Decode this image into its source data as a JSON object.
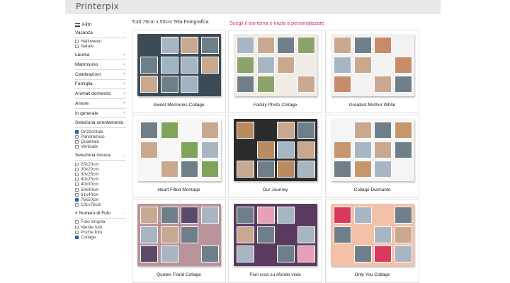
{
  "header": {
    "logo": "Printerpix"
  },
  "sidebar": {
    "filters_label": "Filtri",
    "sections": [
      {
        "label": "Vacanza",
        "chevron": "-",
        "options": [
          {
            "label": "Halloween",
            "checked": false
          },
          {
            "label": "Natale",
            "checked": false
          }
        ]
      },
      {
        "label": "Laurea",
        "chevron": "+"
      },
      {
        "label": "Matrimonio",
        "chevron": "+"
      },
      {
        "label": "Celebrazioni",
        "chevron": "+"
      },
      {
        "label": "Famiglia",
        "chevron": "+"
      },
      {
        "label": "Animali domestici",
        "chevron": "+"
      },
      {
        "label": "Amore",
        "chevron": "+"
      },
      {
        "label": "In generale",
        "chevron": "+"
      },
      {
        "label": "Seleziona orientamento",
        "chevron": "-",
        "options": [
          {
            "label": "Orizzontale",
            "checked": true
          },
          {
            "label": "Panoramico",
            "checked": false
          },
          {
            "label": "Quadrato",
            "checked": false
          },
          {
            "label": "Verticale",
            "checked": false
          }
        ]
      },
      {
        "label": "Seleziona misura",
        "chevron": "-",
        "options": [
          {
            "label": "25x20cm",
            "checked": false
          },
          {
            "label": "30x20cm",
            "checked": false
          },
          {
            "label": "30x25cm",
            "checked": false
          },
          {
            "label": "40x25cm",
            "checked": false
          },
          {
            "label": "40x30cm",
            "checked": false
          },
          {
            "label": "50x40cm",
            "checked": false
          },
          {
            "label": "61x40cm",
            "checked": false
          },
          {
            "label": "76x50cm",
            "checked": true
          },
          {
            "label": "101x76cm",
            "checked": false
          }
        ]
      },
      {
        "label": "# Numero di Foto",
        "chevron": "-",
        "options": [
          {
            "label": "Foto singola",
            "checked": false
          },
          {
            "label": "Niente foto",
            "checked": false
          },
          {
            "label": "Poche foto",
            "checked": false
          },
          {
            "label": "Collage",
            "checked": true
          }
        ]
      }
    ]
  },
  "main": {
    "title": "Tutti 76cm x 50cm Tela Fotografica",
    "cta": "Scegli il tuo tema e inizia a personalizzare",
    "cta_color": "#d6247e",
    "products": [
      {
        "name": "Sweet Memories Collage",
        "bg": "#3c4a55",
        "accent": "#9fb3c2"
      },
      {
        "name": "Family Photo Collage",
        "bg": "#f1ede6",
        "accent": "#8aa36a"
      },
      {
        "name": "Greatest Mother White",
        "bg": "#f2f2f2",
        "accent": "#c98a6a"
      },
      {
        "name": "Heart Filled Montage",
        "bg": "#f7f7f7",
        "accent": "#7fa35a"
      },
      {
        "name": "Our Journey",
        "bg": "#2b2b2b",
        "accent": "#b98b5e"
      },
      {
        "name": "Collage Diamante",
        "bg": "#f4f4f4",
        "accent": "#c5956c"
      },
      {
        "name": "Quotes Floral Collage",
        "bg": "#b9939a",
        "accent": "#5b4b6b"
      },
      {
        "name": "Fiori rosa su sfondo viola",
        "bg": "#5a3a5e",
        "accent": "#e6a0b8"
      },
      {
        "name": "Only You Collage",
        "bg": "#f3c1a8",
        "accent": "#d8395f"
      }
    ]
  }
}
